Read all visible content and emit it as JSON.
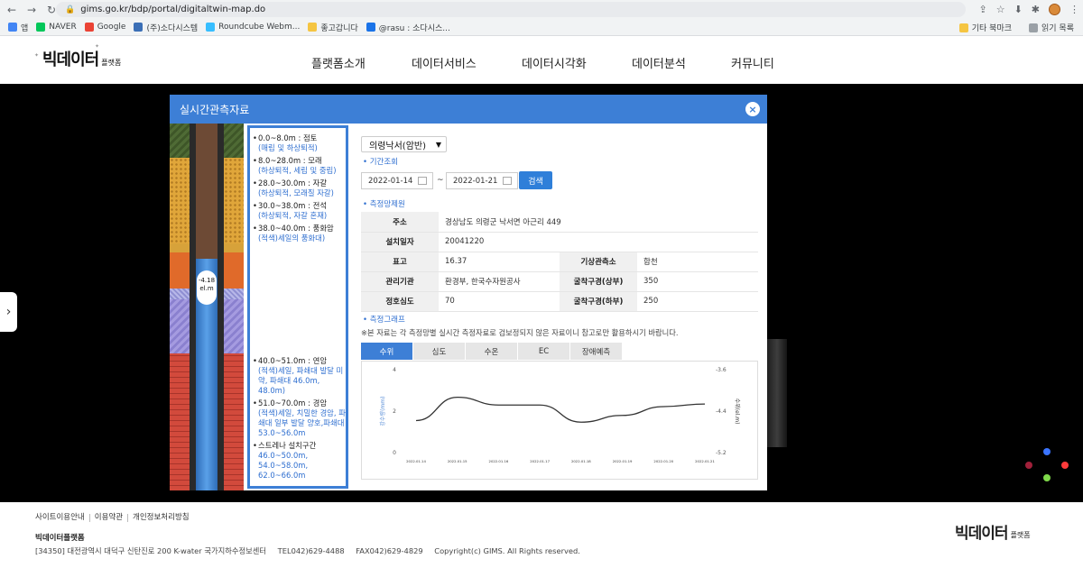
{
  "browser": {
    "url": "gims.go.kr/bdp/portal/digitaltwin-map.do",
    "bookmarks": [
      "앱",
      "NAVER",
      "Google",
      "(주)소다시스템",
      "Roundcube Webm...",
      "좋고갑니다",
      "@rasu : 소다시스..."
    ],
    "bookmarks_right": [
      "기타 북마크",
      "읽기 목록"
    ]
  },
  "site": {
    "logo_main": "빅데이터",
    "logo_sub": "플랫폼",
    "nav": [
      "플랫폼소개",
      "데이터서비스",
      "데이터시각화",
      "데이터분석",
      "커뮤니티"
    ]
  },
  "modal": {
    "title": "실시간관측자료",
    "close_label": "×",
    "water_level_badge": "-4.18 el.m",
    "layers": [
      {
        "depth": "0.0~8.0m : 점토",
        "desc": "(매립 및 하상퇴적)"
      },
      {
        "depth": "8.0~28.0m : 모래",
        "desc": "(하상퇴적, 세립 및 중립)"
      },
      {
        "depth": "28.0~30.0m : 자갈",
        "desc": "(하상퇴적, 모래질 자갈)"
      },
      {
        "depth": "30.0~38.0m : 전석",
        "desc": "(하상퇴적, 자갈 혼재)"
      },
      {
        "depth": "38.0~40.0m : 풍화암",
        "desc": "(적색)세일의 풍화대)"
      },
      {
        "depth": "40.0~51.0m : 연암",
        "desc": "(적색)세일, 파쇄대 발달 미약, 파쇄대 46.0m, 48.0m)"
      },
      {
        "depth": "51.0~70.0m : 경암",
        "desc": "(적색)세일, 치밀한 경암, 파쇄대 일부 발달 양호,파쇄대 53.0~56.0m"
      },
      {
        "depth": "스트레나 설치구간",
        "desc": "46.0~50.0m, 54.0~58.0m, 62.0~66.0m"
      }
    ],
    "station_select": "의령낙서(암반)",
    "period_title": "기간조회",
    "date_from": "2022-01-14",
    "date_sep": "~",
    "date_to": "2022-01-21",
    "search_label": "검색",
    "station_title": "측정망제원",
    "info": {
      "address_label": "주소",
      "address": "경상남도 의령군 낙서면 아근리 449",
      "install_label": "설치일자",
      "install": "20041220",
      "elev_label": "표고",
      "elev": "16.37",
      "weather_label": "기상관측소",
      "weather": "합천",
      "agency_label": "관리기관",
      "agency": "환경부, 한국수자원공사",
      "diam_top_label": "굴착구경(상부)",
      "diam_top": "350",
      "depth_label": "정호심도",
      "depth": "70",
      "diam_bot_label": "굴착구경(하부)",
      "diam_bot": "250"
    },
    "graph_title": "측정그래프",
    "note": "※본 자료는 각 측정망별 실시간 측정자료로 검보정되지 않은 자료이니 참고로만 활용하시기 바랍니다.",
    "tabs": [
      "수위",
      "심도",
      "수온",
      "EC",
      "장애예측"
    ],
    "active_tab": "수위"
  },
  "chart_data": {
    "type": "line",
    "ylabel": "강수량(mm)",
    "y2label": "수위(el.m)",
    "ylim": [
      0,
      4
    ],
    "y2lim": [
      -5.2,
      -3.6
    ],
    "yticks": [
      "4",
      "2",
      "0"
    ],
    "y2ticks": [
      "-3.6",
      "-4.4",
      "-5.2"
    ],
    "x": [
      "2022.01.14",
      "2022.01.15",
      "2022.01.16",
      "2022.01.17",
      "2022.01.18",
      "2022.01.19",
      "2022.01.20",
      "2022.01.21"
    ],
    "series": [
      {
        "values": [
          -4.6,
          -4.15,
          -4.3,
          -4.3,
          -4.63,
          -4.5,
          -4.33,
          -4.28
        ],
        "color": "#333333"
      }
    ]
  },
  "footer": {
    "links": [
      "사이트이용안내",
      "이용약관",
      "개인정보처리방침"
    ],
    "name": "빅데이터플랫폼",
    "address": "[34350] 대전광역시 대덕구 신탄진로 200 K-water 국가지하수정보센터",
    "tel": "TEL042)629-4488",
    "fax": "FAX042)629-4829",
    "copyright": "Copyright(c) GIMS. All Rights reserved."
  }
}
